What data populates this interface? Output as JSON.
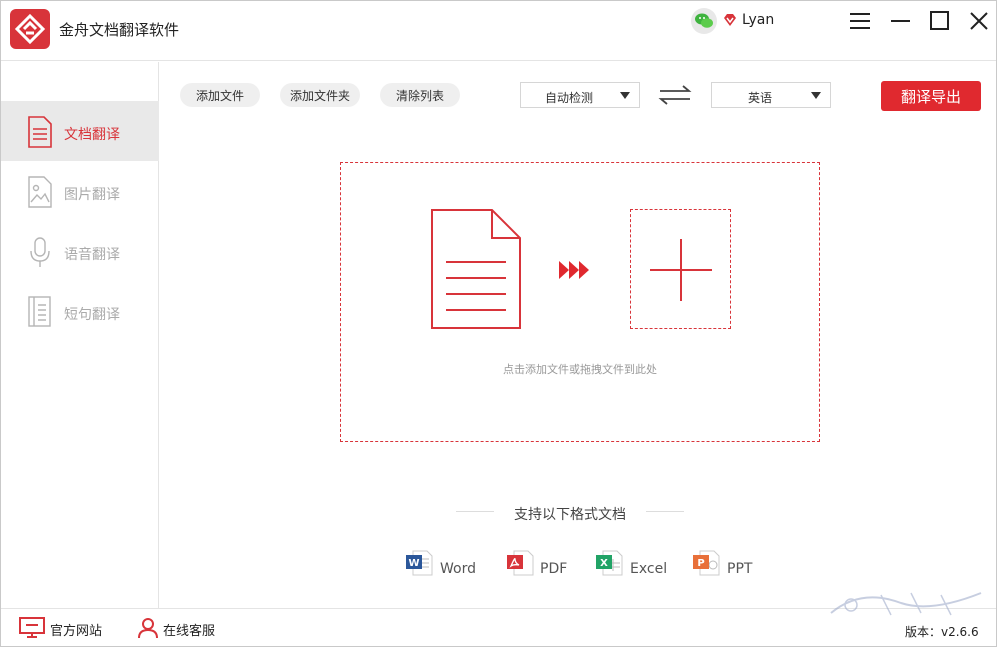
{
  "app": {
    "title": "金舟文档翻译软件",
    "username": "Lyan"
  },
  "sidebar": {
    "items": [
      {
        "label": "文档翻译",
        "active": true
      },
      {
        "label": "图片翻译",
        "active": false
      },
      {
        "label": "语音翻译",
        "active": false
      },
      {
        "label": "短句翻译",
        "active": false
      }
    ]
  },
  "toolbar": {
    "add_file": "添加文件",
    "add_folder": "添加文件夹",
    "clear_list": "清除列表",
    "source_lang": "自动检测",
    "target_lang": "英语",
    "export": "翻译导出"
  },
  "dropzone": {
    "hint": "点击添加文件或拖拽文件到此处"
  },
  "formats": {
    "title": "支持以下格式文档",
    "items": [
      {
        "name": "Word",
        "icon": "word-icon",
        "color": "#2b579a"
      },
      {
        "name": "PDF",
        "icon": "pdf-icon",
        "color": "#d8343a"
      },
      {
        "name": "Excel",
        "icon": "excel-icon",
        "color": "#21a366"
      },
      {
        "name": "PPT",
        "icon": "ppt-icon",
        "color": "#e8703a"
      }
    ]
  },
  "footer": {
    "website": "官方网站",
    "support": "在线客服",
    "version": "版本：v2.6.6"
  },
  "colors": {
    "accent": "#d8343a",
    "button": "#e0292f"
  }
}
